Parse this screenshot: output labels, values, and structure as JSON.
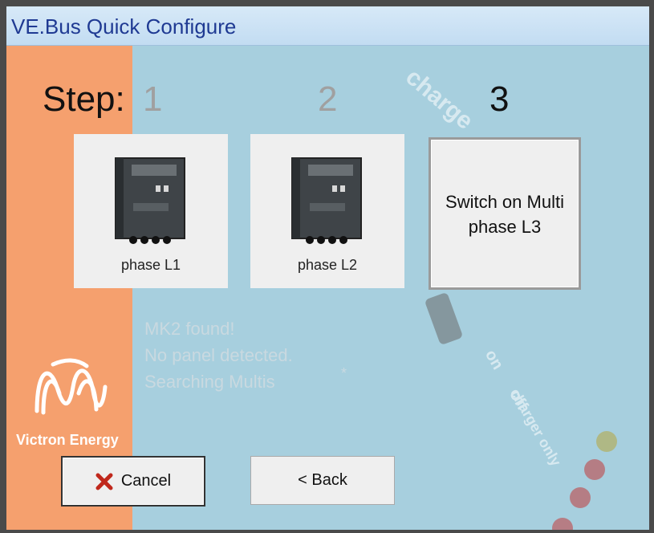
{
  "window": {
    "title": "VE.Bus Quick Configure"
  },
  "steps": {
    "label": "Step:",
    "one": "1",
    "two": "2",
    "three": "3"
  },
  "phases": [
    {
      "label": "phase L1"
    },
    {
      "label": "phase L2"
    },
    {
      "label": "Switch on Multi phase L3"
    }
  ],
  "status": {
    "line1": "MK2 found!",
    "line2": "No panel detected.",
    "line3": "Searching Multis",
    "spinner": "*"
  },
  "buttons": {
    "cancel": "Cancel",
    "back": "< Back"
  },
  "brand": {
    "text": "Victron Energy"
  },
  "colors": {
    "title_text": "#1f3a93",
    "content_bg": "#a7cfde",
    "orange_strip": "#f5a06e",
    "inactive_step": "#a0a0a0",
    "cancel_icon": "#c0281c"
  }
}
